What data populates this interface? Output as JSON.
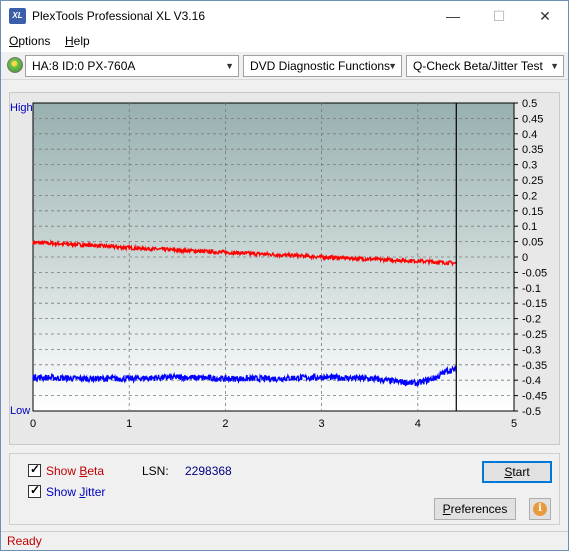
{
  "window": {
    "title": "PlexTools Professional XL V3.16",
    "icon_label": "XL",
    "minimize_glyph": "—",
    "maximize_glyph": "☐",
    "close_glyph": "✕"
  },
  "menu": {
    "options": {
      "accel": "O",
      "rest": "ptions"
    },
    "help": {
      "accel": "H",
      "rest": "elp"
    }
  },
  "toolbar": {
    "drive": "HA:8 ID:0  PX-760A",
    "function": "DVD Diagnostic Functions",
    "test": "Q-Check Beta/Jitter Test",
    "arrow": "▼"
  },
  "chart_data": {
    "type": "line",
    "left_axis_labels": {
      "top": "High",
      "bottom": "Low"
    },
    "xlim": [
      0,
      5
    ],
    "x_ticks": [
      "0",
      "1",
      "2",
      "3",
      "4",
      "5"
    ],
    "ylim": [
      -0.5,
      0.5
    ],
    "y_ticks": [
      "0.5",
      "0.45",
      "0.4",
      "0.35",
      "0.3",
      "0.25",
      "0.2",
      "0.15",
      "0.1",
      "0.05",
      "0",
      "-0.05",
      "-0.1",
      "-0.15",
      "-0.2",
      "-0.25",
      "-0.3",
      "-0.35",
      "-0.4",
      "-0.45",
      "-0.5"
    ],
    "cursor_x": 4.4,
    "grid": true,
    "series": [
      {
        "key": "beta",
        "color": "#ff0000",
        "x": [
          0,
          0.5,
          1.0,
          1.5,
          2.0,
          2.5,
          3.0,
          3.5,
          4.0,
          4.4
        ],
        "y": [
          0.047,
          0.04,
          0.03,
          0.022,
          0.015,
          0.008,
          0.0,
          -0.007,
          -0.013,
          -0.02
        ]
      },
      {
        "key": "jitter",
        "color": "#0000ff",
        "x": [
          0,
          0.5,
          1.0,
          1.5,
          2.0,
          2.5,
          3.0,
          3.5,
          3.8,
          4.0,
          4.1,
          4.2,
          4.3,
          4.4
        ],
        "y": [
          -0.39,
          -0.395,
          -0.395,
          -0.39,
          -0.395,
          -0.395,
          -0.39,
          -0.395,
          -0.405,
          -0.41,
          -0.4,
          -0.39,
          -0.37,
          -0.365
        ]
      }
    ],
    "background_top": "#98b0b0",
    "background_bottom": "#ffffff"
  },
  "controls": {
    "show_beta": {
      "prefix": "Show ",
      "accel": "B",
      "rest": "eta",
      "checked": true,
      "color": "#c00000"
    },
    "show_jitter": {
      "prefix": "Show ",
      "accel": "J",
      "rest": "itter",
      "checked": true,
      "color": "#0000c0"
    },
    "lsn_label": "LSN:",
    "lsn_value": "2298368",
    "start": {
      "accel": "S",
      "rest": "tart"
    },
    "preferences": {
      "accel": "P",
      "rest": "references"
    },
    "info_glyph": "i"
  },
  "status": {
    "text": "Ready"
  }
}
